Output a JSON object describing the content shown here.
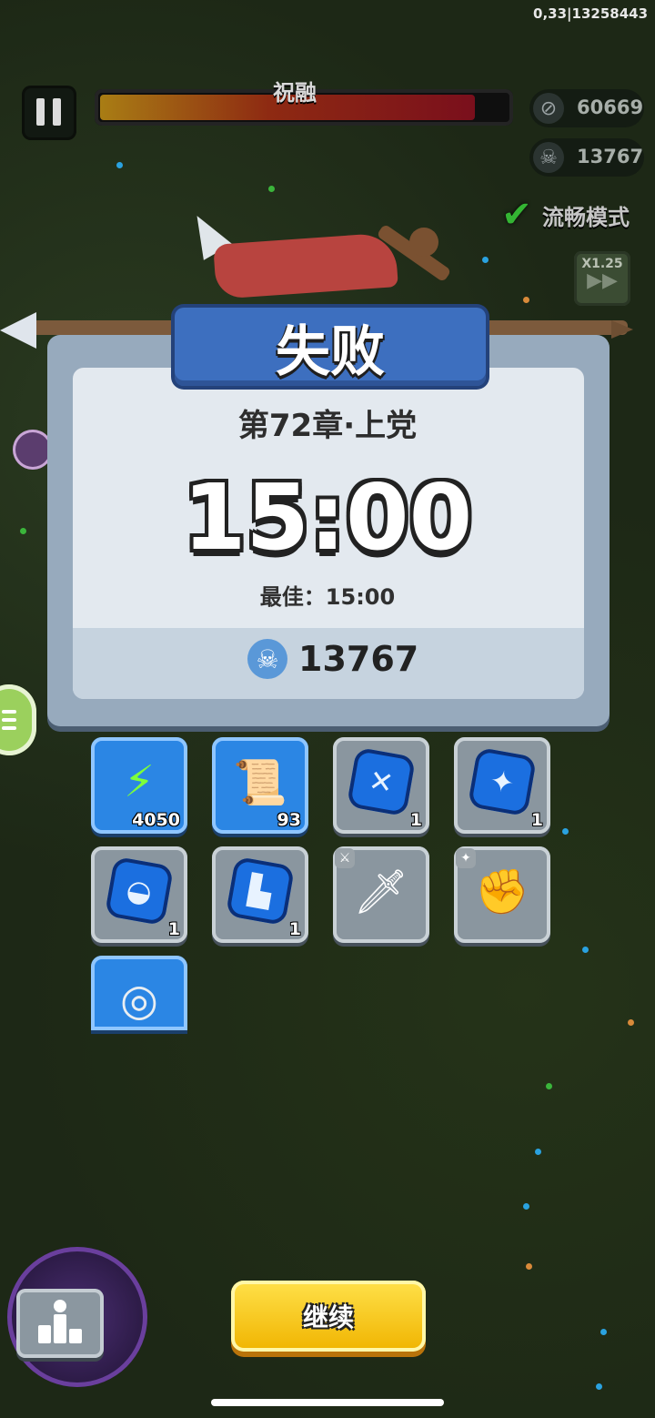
{
  "debug_info": "0,33|13258443",
  "hud": {
    "boss_name": "祝融",
    "boss_hp_fraction": 0.92,
    "coins": "60669",
    "kills": "13767",
    "smooth_mode_label": "流畅模式",
    "speed_label": "X1.25"
  },
  "result": {
    "title": "失败",
    "chapter": "第72章·上党",
    "time": "15:00",
    "best": "最佳：15:00",
    "kills": "13767"
  },
  "rewards": [
    {
      "icon": "lightning-icon",
      "count": "4050",
      "style": "blue"
    },
    {
      "icon": "scroll-icon",
      "count": "93",
      "style": "blue"
    },
    {
      "icon": "weapon-gem-icon",
      "count": "1",
      "style": "gray"
    },
    {
      "icon": "armor-gem-icon",
      "count": "1",
      "style": "gray"
    },
    {
      "icon": "helmet-gem-icon",
      "count": "1",
      "style": "gray"
    },
    {
      "icon": "boots-gem-icon",
      "count": "1",
      "style": "gray"
    },
    {
      "icon": "glaive-weapon-icon",
      "count": "",
      "style": "gray"
    },
    {
      "icon": "gauntlet-armor-icon",
      "count": "",
      "style": "gray"
    },
    {
      "icon": "silver-coin-icon",
      "count": "",
      "style": "blue"
    }
  ],
  "buttons": {
    "continue_label": "继续"
  },
  "colors": {
    "continue_button": "#f5c400",
    "banner": "#3d6fbf",
    "boss_bar": "#8e2a12"
  }
}
